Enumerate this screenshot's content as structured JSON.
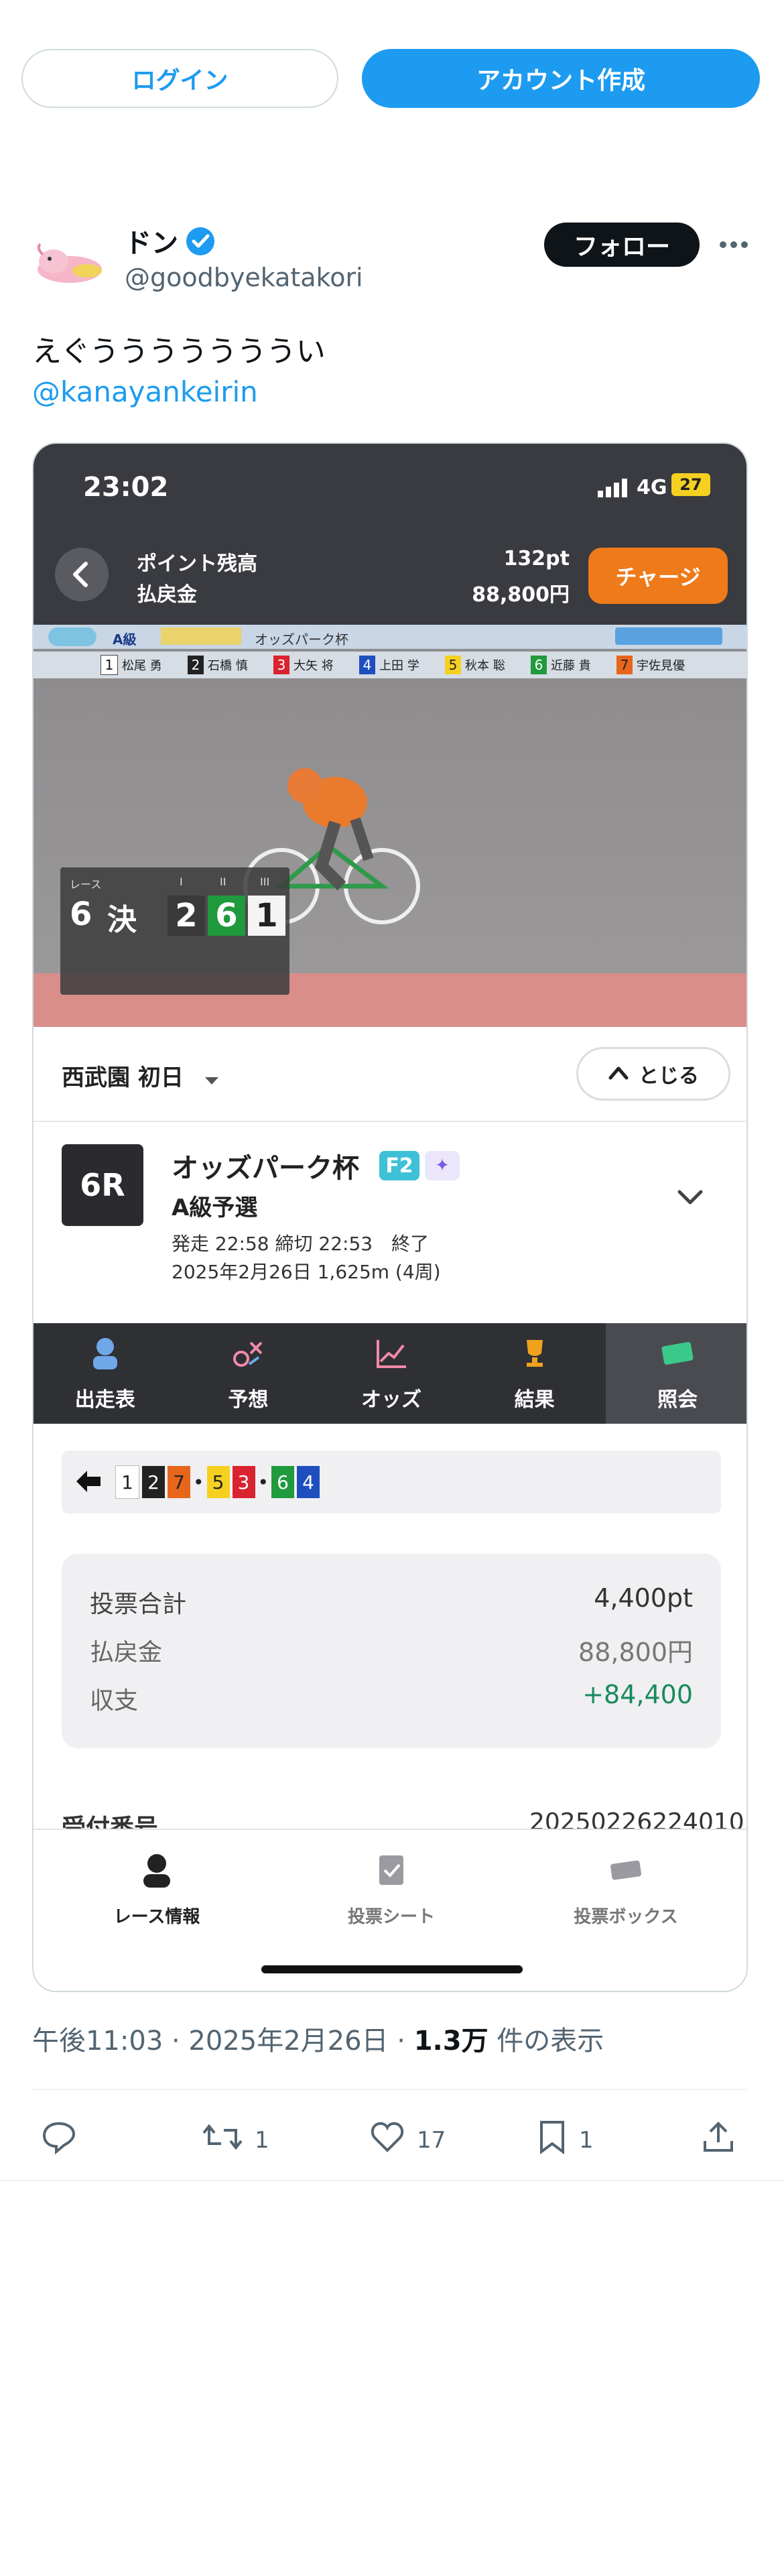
{
  "header": {
    "login_label": "ログイン",
    "signup_label": "アカウント作成"
  },
  "tweet": {
    "display_name": "ドン",
    "handle": "@goodbyekatakori",
    "follow_label": "フォロー",
    "text": "えぐうううううううい",
    "mention": "@kanayankeirin",
    "timestamp": "午後11:03 · 2025年2月26日 · ",
    "views_count": "1.3万",
    "views_label": " 件の表示",
    "retweets": "1",
    "likes": "17",
    "bookmarks": "1"
  },
  "app": {
    "status_time": "23:02",
    "network": "4G",
    "battery": "27",
    "points_label": "ポイント残高",
    "payout_label": "払戻金",
    "points_value": "132pt",
    "payout_value": "88,800円",
    "charge_label": "チャージ",
    "video": {
      "race_label": "レース",
      "board_cols": [
        "I",
        "II",
        "III"
      ],
      "board_race": "6",
      "board_final": "決",
      "board_order": [
        "2",
        "6",
        "1"
      ],
      "top_left": "A級",
      "top_title": "オッズパーク杯",
      "riders": [
        {
          "num": "1",
          "name": "松尾 勇"
        },
        {
          "num": "2",
          "name": "石橋 慎"
        },
        {
          "num": "3",
          "name": "大矢 将"
        },
        {
          "num": "4",
          "name": "上田 学"
        },
        {
          "num": "5",
          "name": "秋本 聡"
        },
        {
          "num": "6",
          "name": "近藤 貴"
        },
        {
          "num": "7",
          "name": "宇佐見優"
        }
      ]
    },
    "venue": "西武園 初日",
    "close_label": "とじる",
    "race": {
      "number": "6R",
      "title": "オッズパーク杯",
      "badge": "F2",
      "subtitle": "A級予選",
      "time": "発走 22:58 締切 22:53　終了",
      "date": "2025年2月26日 1,625m (4周)"
    },
    "tabs": [
      "出走表",
      "予想",
      "オッズ",
      "結果",
      "照会"
    ],
    "combo": [
      "1",
      "2",
      "7",
      "5",
      "3",
      "6",
      "4"
    ],
    "summary": {
      "total_label": "投票合計",
      "total_value": "4,400pt",
      "payout_label": "払戻金",
      "payout_value": "88,800円",
      "balance_label": "収支",
      "balance_value": "+84,400"
    },
    "cut_label": "受付番号",
    "cut_value": "20250226224010",
    "bottom_nav": [
      "レース情報",
      "投票シート",
      "投票ボックス"
    ]
  },
  "colors": {
    "accent": "#1d9bf0",
    "charge": "#ef7a1a",
    "positive": "#1a8a5a",
    "frame_colors": [
      "#ffffff",
      "#222222",
      "#e8661b",
      "#f5d021",
      "#d9232f",
      "#1f9a3c",
      "#1f4fbf"
    ]
  }
}
